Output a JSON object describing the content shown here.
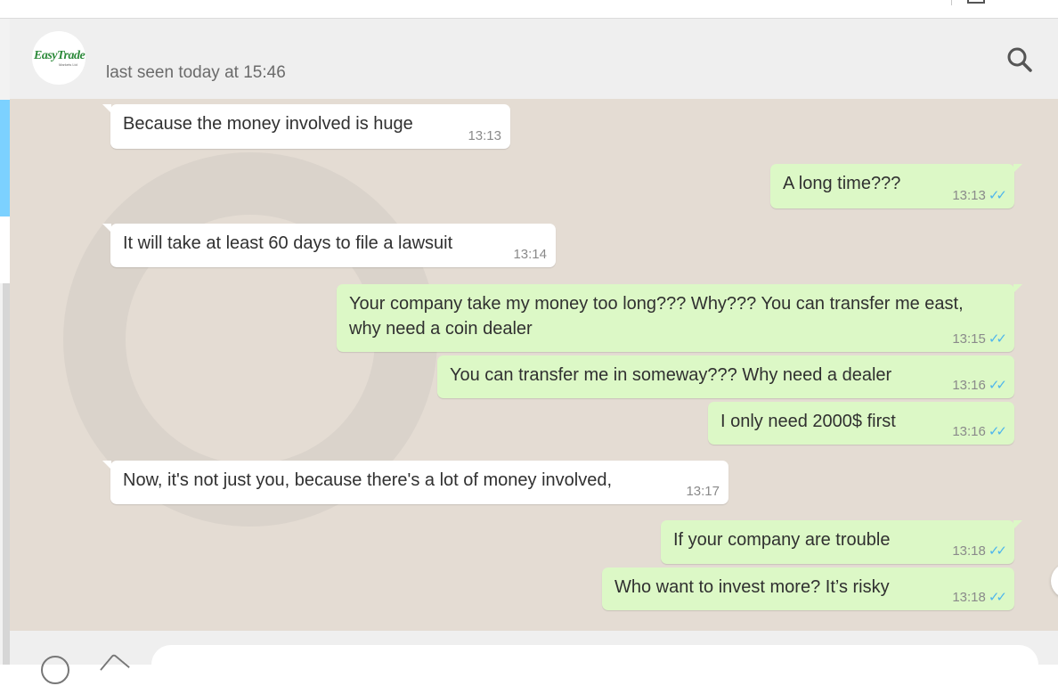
{
  "chat": {
    "header": {
      "avatar_logo_text": "EasyTrade",
      "avatar_logo_sub": "Markets Ltd",
      "status": "last seen today at 15:46",
      "search_icon": "search-icon"
    },
    "messages": [
      {
        "dir": "in",
        "text": "Because the money involved is huge",
        "time": "13:13"
      },
      {
        "dir": "out",
        "text": "A long time???",
        "time": "13:13",
        "status": "read"
      },
      {
        "dir": "in",
        "text": "It will take at least 60 days to file a lawsuit",
        "time": "13:14"
      },
      {
        "dir": "out",
        "text": "Your company take my money too long??? Why??? You can transfer me east,",
        "text2": "why need a coin dealer",
        "time": "13:15",
        "status": "read"
      },
      {
        "dir": "out",
        "text": "You can transfer me in someway??? Why need a dealer",
        "time": "13:16",
        "status": "read"
      },
      {
        "dir": "out",
        "text": "I only need 2000$ first",
        "time": "13:16",
        "status": "read"
      },
      {
        "dir": "in",
        "text": "Now, it's not just you, because there's a lot of money involved,",
        "time": "13:17"
      },
      {
        "dir": "out",
        "text": "If your company are trouble",
        "time": "13:18",
        "status": "read"
      },
      {
        "dir": "out",
        "text": "Who want to invest more? It’s risky",
        "time": "13:18",
        "status": "read"
      }
    ],
    "read_tick": "✓✓",
    "composer": {
      "emoji_icon": "emoji-icon",
      "attach_icon": "attach-icon"
    }
  },
  "colors": {
    "incoming_bubble": "#ffffff",
    "outgoing_bubble": "#dcf8c6",
    "read_tick": "#4fb6ec",
    "chat_bg": "#e4dcd3"
  }
}
